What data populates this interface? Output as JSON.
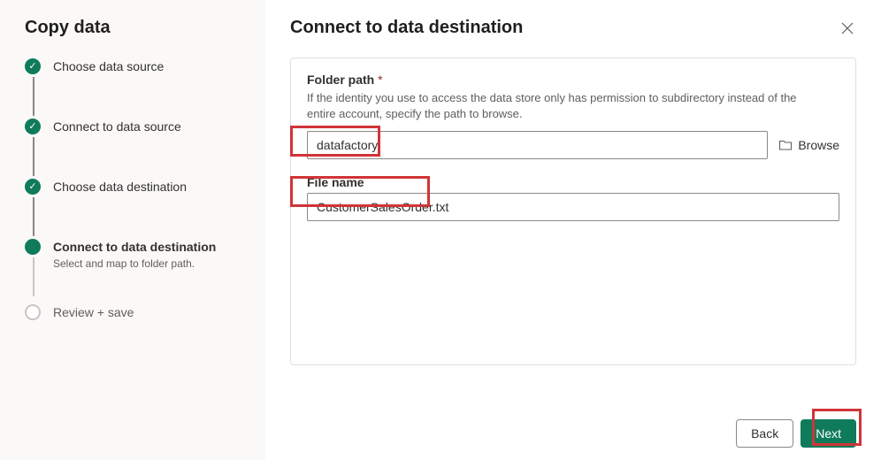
{
  "sidebar": {
    "title": "Copy data",
    "steps": [
      {
        "label": "Choose data source",
        "state": "completed"
      },
      {
        "label": "Connect to data source",
        "state": "completed"
      },
      {
        "label": "Choose data destination",
        "state": "completed"
      },
      {
        "label": "Connect to data destination",
        "sub": "Select and map to folder path.",
        "state": "current"
      },
      {
        "label": "Review + save",
        "state": "future"
      }
    ]
  },
  "main": {
    "title": "Connect to data destination",
    "folder": {
      "label": "Folder path",
      "required_marker": "*",
      "description": "If the identity you use to access the data store only has permission to subdirectory instead of the entire account, specify the path to browse.",
      "value": "datafactory",
      "browse": "Browse"
    },
    "file": {
      "label": "File name",
      "value": "CustomerSalesOrder.txt"
    }
  },
  "footer": {
    "back": "Back",
    "next": "Next"
  }
}
